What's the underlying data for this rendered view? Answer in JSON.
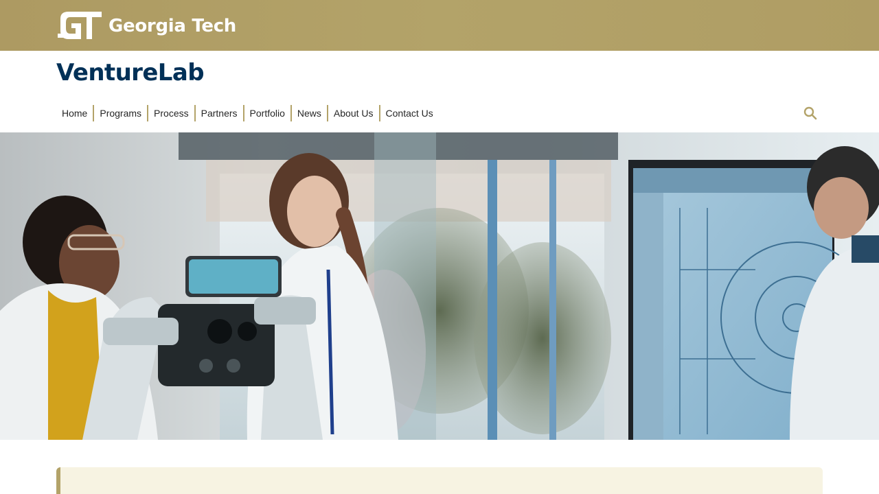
{
  "header": {
    "brand_name": "Georgia Tech",
    "brand_monogram": "GT"
  },
  "site": {
    "title": "VentureLab"
  },
  "nav": {
    "items": [
      {
        "label": "Home"
      },
      {
        "label": "Programs"
      },
      {
        "label": "Process"
      },
      {
        "label": "Partners"
      },
      {
        "label": "Portfolio"
      },
      {
        "label": "News"
      },
      {
        "label": "About Us"
      },
      {
        "label": "Contact Us"
      }
    ],
    "search_icon": "search-icon"
  },
  "hero": {
    "image": "photo of researchers in lab coats with robotic equipment and a CAD blueprint on a monitor"
  },
  "colors": {
    "gold": "#b3a369",
    "navy": "#003057",
    "callout_bg": "#f7f3e2"
  }
}
